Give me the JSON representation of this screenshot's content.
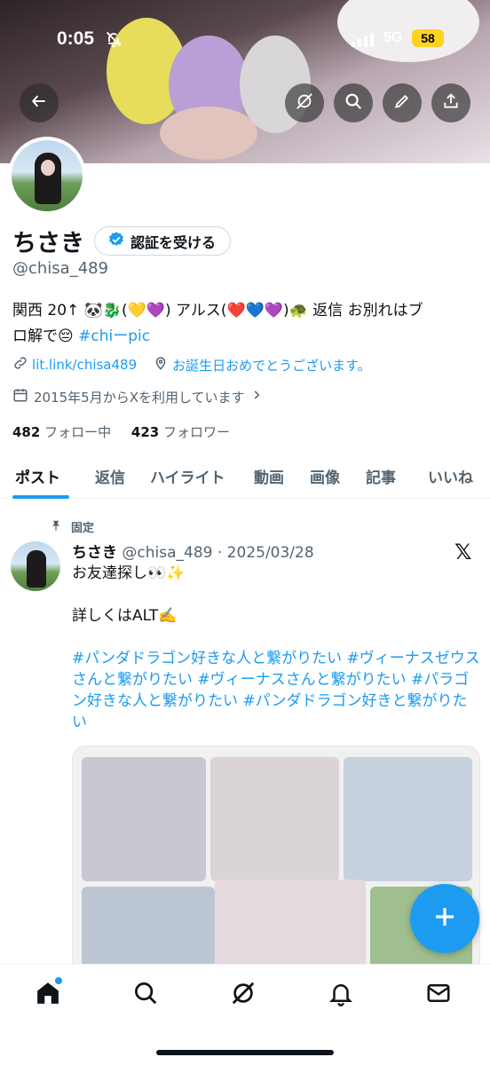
{
  "status_bar": {
    "time": "0:05",
    "network": "5G",
    "battery": "58"
  },
  "profile": {
    "name": "ちさき",
    "verify_label": "認証を受ける",
    "handle": "@chisa_489",
    "bio_line1": "関西 20↑ 🐼🐉(💛💜) アルス(❤️💙💜)🐢 返信 お別れはブ",
    "bio_line2_text": "ロ解で😔 ",
    "bio_hashtag": "#chiーpic",
    "link": "lit.link/chisa489",
    "location": "お誕生日おめでとうございます。",
    "joined": "2015年5月からXを利用しています",
    "following_count": "482",
    "following_label": "フォロー中",
    "followers_count": "423",
    "followers_label": "フォロワー"
  },
  "tabs": [
    "ポスト",
    "返信",
    "ハイライト",
    "動画",
    "画像",
    "記事",
    "いいね"
  ],
  "post": {
    "pinned_label": "固定",
    "author": "ちさき",
    "handle_date": "@chisa_489 · 2025/03/28",
    "line1": "お友達探し👀✨",
    "line2": "詳しくはALT✍️",
    "hashtags": "#パンダドラゴン好きな人と繋がりたい #ヴィーナスゼウスさんと繋がりたい #ヴィーナスさんと繋がりたい #パラゴン好きな人と繋がりたい #パンダドラゴン好きと繋がりたい"
  },
  "icons": {
    "back": "arrow-left-icon",
    "grok": "grok-icon",
    "search": "search-icon",
    "edit": "pencil-icon",
    "share": "share-icon"
  },
  "colors": {
    "accent": "#1d9bf0",
    "text": "#0f1419",
    "secondary": "#536471"
  }
}
